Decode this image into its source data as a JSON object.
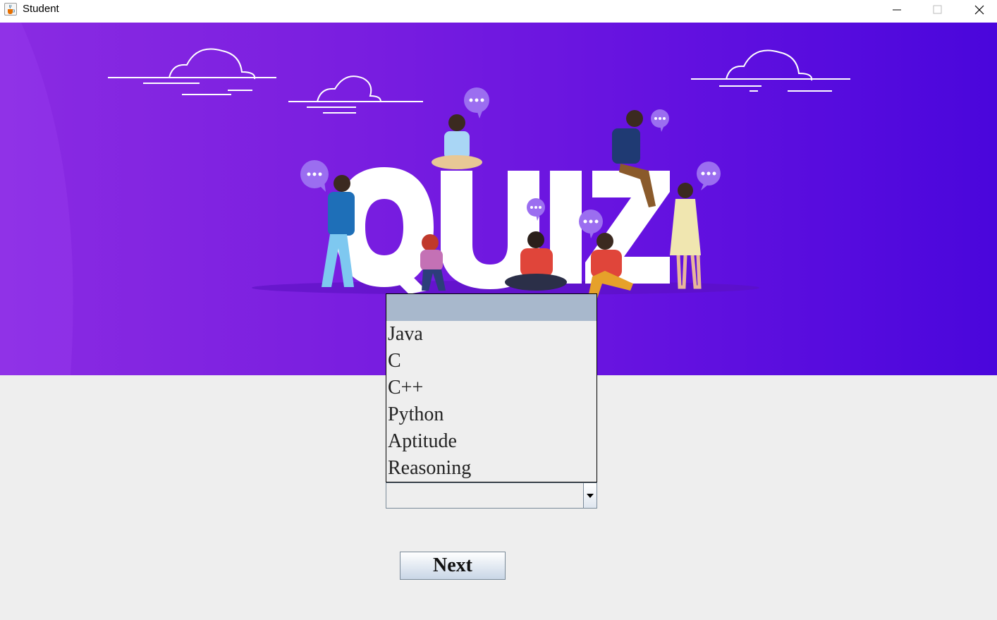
{
  "window": {
    "title": "Student",
    "controls": {
      "minimize": "minimize-icon",
      "maximize": "maximize-icon",
      "close": "close-icon"
    }
  },
  "banner": {
    "word": "QUIZ",
    "colors": {
      "gradient_start": "#8a2be2",
      "gradient_end": "#4a06dc",
      "text": "#ffffff",
      "bubble": "#9b6ef0"
    }
  },
  "subject_dropdown": {
    "selected_value": "",
    "options": [
      "",
      "Java",
      "C",
      "C++",
      "Python",
      "Aptitude",
      "Reasoning"
    ],
    "highlighted_index": 0
  },
  "next_button": {
    "label": "Next"
  }
}
